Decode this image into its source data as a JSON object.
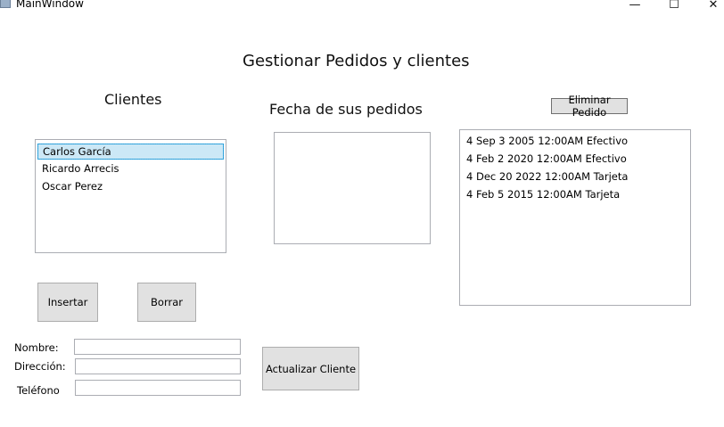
{
  "window": {
    "title": "MainWindow",
    "controls": {
      "minimize": "—",
      "maximize": "☐",
      "close": "✕"
    }
  },
  "main": {
    "title": "Gestionar Pedidos y clientes",
    "clientes_label": "Clientes",
    "fechas_label": "Fecha de sus pedidos"
  },
  "clientes": {
    "items": [
      "Carlos García",
      "Ricardo Arrecis",
      "Oscar Perez"
    ],
    "selected_index": 0
  },
  "pedidos": {
    "items": [
      "4 Sep  3 2005 12:00AM Efectivo",
      "4 Feb  2 2020 12:00AM Efectivo",
      "4 Dec 20 2022 12:00AM Tarjeta",
      "4 Feb  5 2015 12:00AM Tarjeta"
    ]
  },
  "buttons": {
    "eliminar": "Eliminar Pedido",
    "insertar": "Insertar",
    "borrar": "Borrar",
    "actualizar": "Actualizar Cliente"
  },
  "form": {
    "nombre_label": "Nombre:",
    "direccion_label": "Dirección:",
    "telefono_label": "Teléfono",
    "nombre_value": "",
    "direccion_value": "",
    "telefono_value": ""
  },
  "colors": {
    "selection_bg": "#cce8f6",
    "selection_border": "#3ca5dc",
    "button_bg": "#e1e1e1"
  }
}
